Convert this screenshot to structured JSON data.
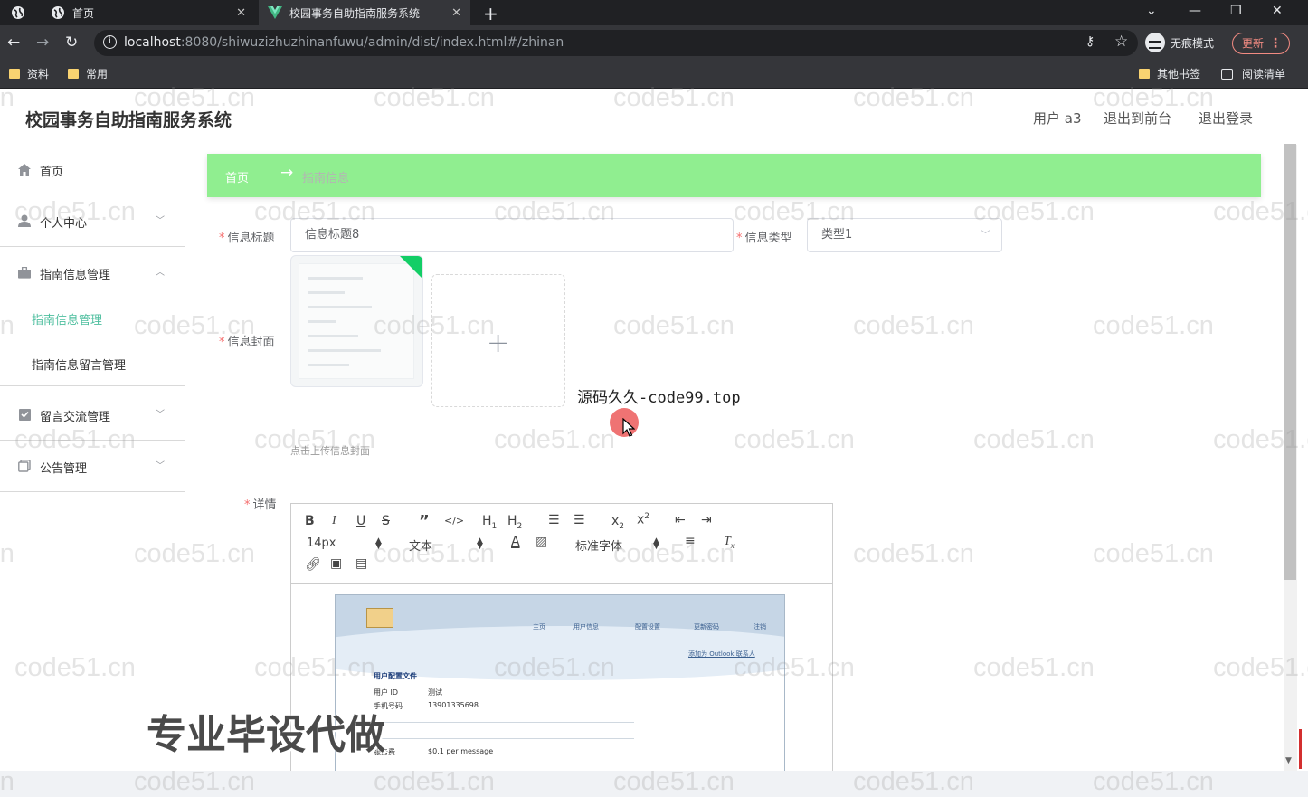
{
  "browser": {
    "tabs": [
      {
        "title": "首页"
      },
      {
        "title": "校园事务自助指南服务系统"
      }
    ],
    "url_host": "localhost",
    "url_rest": ":8080/shiwuzizhuzhinanfuwu/admin/dist/index.html#/zhinan",
    "incognito_label": "无痕模式",
    "update_label": "更新",
    "bookmarks": [
      "资料",
      "常用"
    ],
    "other_bookmarks": "其他书签",
    "reading_list": "阅读清单"
  },
  "header": {
    "title": "校园事务自助指南服务系统",
    "user": "用户 a3",
    "to_front": "退出到前台",
    "logout": "退出登录"
  },
  "sidebar": {
    "items": [
      {
        "label": "首页",
        "icon": "home-icon"
      },
      {
        "label": "个人中心",
        "icon": "user-icon"
      },
      {
        "label": "指南信息管理",
        "icon": "briefcase-icon"
      },
      {
        "label": "留言交流管理",
        "icon": "checklist-icon"
      },
      {
        "label": "公告管理",
        "icon": "copy-icon"
      }
    ],
    "submenu": [
      "指南信息管理",
      "指南信息留言管理"
    ]
  },
  "breadcrumb": {
    "home": "首页",
    "sep": "→",
    "current": "指南信息"
  },
  "form": {
    "title_label": "信息标题",
    "title_value": "信息标题8",
    "type_label": "信息类型",
    "type_value": "类型1",
    "cover_label": "信息封面",
    "upload_tip": "点击上传信息封面",
    "detail_label": "详情"
  },
  "editor": {
    "font_size": "14px",
    "header_select": "文本",
    "font_family": "标准字体",
    "embedded": {
      "nav": [
        "主页",
        "用户信息",
        "配置设置",
        "更新密码",
        "注销"
      ],
      "link": "添加为 Outlook 联系人",
      "section": "用户配置文件",
      "user_id_label": "用户 ID",
      "user_id_value": "测试",
      "phone_label": "手机号码",
      "phone_value": "13901335698",
      "fee_label": "服务费",
      "fee_value": "$0.1 per message"
    }
  },
  "overlays": {
    "watermark": "code51.cn",
    "promo": "源码久久-code99.top",
    "ad": "专业毕设代做"
  },
  "colors": {
    "accent": "#4fbf9f",
    "breadcrumb_bg": "#90ee90",
    "required": "#f56c6c"
  }
}
